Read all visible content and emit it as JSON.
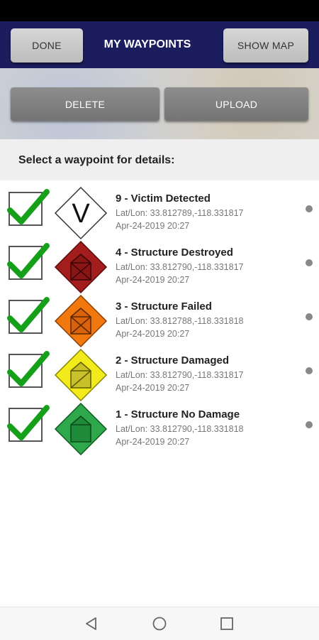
{
  "header": {
    "title": "MY WAYPOINTS",
    "done_label": "DONE",
    "show_map_label": "SHOW MAP",
    "background_color": "#1c1d5e"
  },
  "actions": {
    "delete_label": "DELETE",
    "upload_label": "UPLOAD"
  },
  "list_prompt": "Select a waypoint for details:",
  "waypoints": [
    {
      "title": "9 - Victim Detected",
      "coords": "Lat/Lon: 33.812789,-118.331817",
      "date": "Apr-24-2019 20:27",
      "checked": true,
      "marker": "victim-detected-icon",
      "marker_color": "#ffffff"
    },
    {
      "title": "4 - Structure Destroyed",
      "coords": "Lat/Lon: 33.812790,-118.331817",
      "date": "Apr-24-2019 20:27",
      "checked": true,
      "marker": "structure-destroyed-icon",
      "marker_color": "#a31d1d"
    },
    {
      "title": "3 - Structure Failed",
      "coords": "Lat/Lon: 33.812788,-118.331818",
      "date": "Apr-24-2019 20:27",
      "checked": true,
      "marker": "structure-failed-icon",
      "marker_color": "#f0780f"
    },
    {
      "title": "2 - Structure Damaged",
      "coords": "Lat/Lon: 33.812790,-118.331817",
      "date": "Apr-24-2019 20:27",
      "checked": true,
      "marker": "structure-damaged-icon",
      "marker_color": "#f2ea1a"
    },
    {
      "title": "1 - Structure No Damage",
      "coords": "Lat/Lon: 33.812790,-118.331818",
      "date": "Apr-24-2019 20:27",
      "checked": true,
      "marker": "structure-no-damage-icon",
      "marker_color": "#2ea84a"
    }
  ],
  "marker_letters": {
    "victim": "V"
  },
  "navbar": [
    "back-icon",
    "home-icon",
    "recents-icon"
  ]
}
